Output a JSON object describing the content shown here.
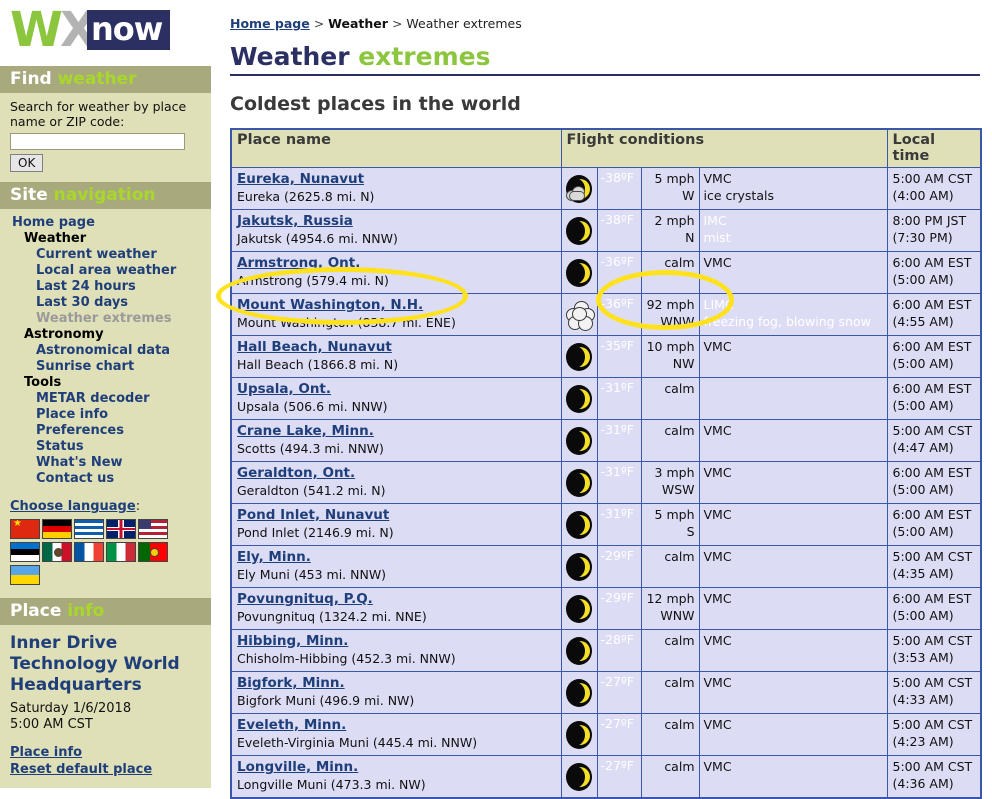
{
  "logo": {
    "part1": "W",
    "part2": "X",
    "part3": "now"
  },
  "find_weather": {
    "head_1": "Find",
    "head_2": "weather",
    "prompt": "Search for weather by place name or ZIP code:",
    "input_value": "",
    "input_placeholder": "",
    "ok_label": "OK"
  },
  "site_navigation": {
    "head_1": "Site",
    "head_2": "navigation",
    "items": [
      {
        "label": "Home page",
        "level": 0,
        "type": "link"
      },
      {
        "label": "Weather",
        "level": 1,
        "type": "plain"
      },
      {
        "label": "Current weather",
        "level": 2,
        "type": "link"
      },
      {
        "label": "Local area weather",
        "level": 2,
        "type": "link"
      },
      {
        "label": "Last 24 hours",
        "level": 2,
        "type": "link"
      },
      {
        "label": "Last 30 days",
        "level": 2,
        "type": "link"
      },
      {
        "label": "Weather extremes",
        "level": 2,
        "type": "current"
      },
      {
        "label": "Astronomy",
        "level": 1,
        "type": "plain"
      },
      {
        "label": "Astronomical data",
        "level": 2,
        "type": "link"
      },
      {
        "label": "Sunrise chart",
        "level": 2,
        "type": "link"
      },
      {
        "label": "Tools",
        "level": 1,
        "type": "plain"
      },
      {
        "label": "METAR decoder",
        "level": 2,
        "type": "link"
      },
      {
        "label": "Place info",
        "level": 2,
        "type": "link"
      },
      {
        "label": "Preferences",
        "level": 2,
        "type": "link"
      },
      {
        "label": "Status",
        "level": 2,
        "type": "link"
      },
      {
        "label": "What's New",
        "level": 2,
        "type": "link"
      },
      {
        "label": "Contact us",
        "level": 2,
        "type": "link"
      }
    ],
    "language_label": "Choose language",
    "language_colon": ":",
    "flags": [
      {
        "name": "china-flag",
        "colors": [
          "#de2910",
          "#ffde00"
        ]
      },
      {
        "name": "germany-flag",
        "colors": [
          "#000000",
          "#dd0000",
          "#ffce00"
        ]
      },
      {
        "name": "greece-flag",
        "colors": [
          "#0d5eaf",
          "#ffffff"
        ]
      },
      {
        "name": "united-kingdom-flag",
        "colors": [
          "#012169",
          "#ffffff",
          "#c8102e"
        ]
      },
      {
        "name": "usa-flag",
        "colors": [
          "#b22234",
          "#ffffff",
          "#3c3b6e"
        ]
      },
      {
        "name": "estonia-flag",
        "colors": [
          "#0072ce",
          "#000000",
          "#ffffff"
        ]
      },
      {
        "name": "mexico-flag",
        "colors": [
          "#006847",
          "#ffffff",
          "#ce1126"
        ]
      },
      {
        "name": "france-flag",
        "colors": [
          "#0055a4",
          "#ffffff",
          "#ef4135"
        ]
      },
      {
        "name": "italy-flag",
        "colors": [
          "#009246",
          "#ffffff",
          "#ce2b37"
        ]
      },
      {
        "name": "portugal-flag",
        "colors": [
          "#006600",
          "#ff0000",
          "#ffcc00"
        ]
      },
      {
        "name": "ukraine-flag",
        "colors": [
          "#5aa5e8",
          "#ffd700"
        ]
      }
    ]
  },
  "place_info": {
    "head_1": "Place",
    "head_2": "info",
    "place_name": "Inner Drive Technology World Headquarters",
    "date": "Saturday 1/6/2018",
    "time": "5:00 AM CST",
    "links": [
      "Place info",
      "Reset default place"
    ]
  },
  "breadcrumb": {
    "home": "Home page",
    "sep1": ">",
    "section": "Weather",
    "sep2": ">",
    "current": "Weather extremes"
  },
  "header": {
    "title_1": "Weather",
    "title_2": "extremes"
  },
  "main": {
    "section_title": "Coldest places in the world"
  },
  "table": {
    "columns": {
      "place_name": "Place name",
      "flight_conditions": "Flight conditions",
      "local_time": "Local time"
    },
    "rows": [
      {
        "place": "Eureka, Nunavut",
        "station": "Eureka (2625.8 mi. N)",
        "icon": "moon-cloud-icon",
        "temp": "-38ºF",
        "wind": "5 mph",
        "wind_dir": "W",
        "cond": "VMC",
        "cond_detail": "ice crystals",
        "cond_type": "vmc",
        "time": "5:00 AM CST",
        "obs_time": "(4:00 AM)"
      },
      {
        "place": "Jakutsk, Russia",
        "station": "Jakutsk (4954.6 mi. NNW)",
        "icon": "moon-icon",
        "temp": "-38ºF",
        "wind": "2 mph",
        "wind_dir": "N",
        "cond": "IMC",
        "cond_detail": "mist",
        "cond_type": "imc",
        "time": "8:00 PM JST",
        "obs_time": "(7:30 PM)"
      },
      {
        "place": "Armstrong, Ont.",
        "station": "Armstrong (579.4 mi. N)",
        "icon": "moon-icon",
        "temp": "-36ºF",
        "wind": "calm",
        "wind_dir": "",
        "cond": "VMC",
        "cond_detail": "",
        "cond_type": "vmc",
        "time": "6:00 AM EST",
        "obs_time": "(5:00 AM)"
      },
      {
        "place": "Mount Washington, N.H.",
        "station": "Mount Washington (838.7 mi. ENE)",
        "icon": "cloud-icon",
        "temp": "-36ºF",
        "wind": "92 mph",
        "wind_dir": "WNW",
        "cond": "LIMC",
        "cond_detail": "freezing fog, blowing snow",
        "cond_type": "imc",
        "time": "6:00 AM EST",
        "obs_time": "(4:55 AM)"
      },
      {
        "place": "Hall Beach, Nunavut",
        "station": "Hall Beach (1866.8 mi. N)",
        "icon": "moon-icon",
        "temp": "-35ºF",
        "wind": "10 mph",
        "wind_dir": "NW",
        "cond": "VMC",
        "cond_detail": "",
        "cond_type": "vmc",
        "time": "6:00 AM EST",
        "obs_time": "(5:00 AM)"
      },
      {
        "place": "Upsala, Ont.",
        "station": "Upsala (506.6 mi. NNW)",
        "icon": "moon-icon",
        "temp": "-31ºF",
        "wind": "calm",
        "wind_dir": "",
        "cond": "",
        "cond_detail": "",
        "cond_type": "none",
        "time": "6:00 AM EST",
        "obs_time": "(5:00 AM)"
      },
      {
        "place": "Crane Lake, Minn.",
        "station": "Scotts (494.3 mi. NNW)",
        "icon": "moon-icon",
        "temp": "-31ºF",
        "wind": "calm",
        "wind_dir": "",
        "cond": "VMC",
        "cond_detail": "",
        "cond_type": "vmc",
        "time": "5:00 AM CST",
        "obs_time": "(4:47 AM)"
      },
      {
        "place": "Geraldton, Ont.",
        "station": "Geraldton (541.2 mi. N)",
        "icon": "moon-icon",
        "temp": "-31ºF",
        "wind": "3 mph",
        "wind_dir": "WSW",
        "cond": "VMC",
        "cond_detail": "",
        "cond_type": "vmc",
        "time": "6:00 AM EST",
        "obs_time": "(5:00 AM)"
      },
      {
        "place": "Pond Inlet, Nunavut",
        "station": "Pond Inlet (2146.9 mi. N)",
        "icon": "moon-icon",
        "temp": "-31ºF",
        "wind": "5 mph",
        "wind_dir": "S",
        "cond": "VMC",
        "cond_detail": "",
        "cond_type": "vmc",
        "time": "6:00 AM EST",
        "obs_time": "(5:00 AM)"
      },
      {
        "place": "Ely, Minn.",
        "station": "Ely Muni (453 mi. NNW)",
        "icon": "moon-icon",
        "temp": "-29ºF",
        "wind": "calm",
        "wind_dir": "",
        "cond": "VMC",
        "cond_detail": "",
        "cond_type": "vmc",
        "time": "5:00 AM CST",
        "obs_time": "(4:35 AM)"
      },
      {
        "place": "Povungnituq, P.Q.",
        "station": "Povungnituq (1324.2 mi. NNE)",
        "icon": "moon-icon",
        "temp": "-29ºF",
        "wind": "12 mph",
        "wind_dir": "WNW",
        "cond": "VMC",
        "cond_detail": "",
        "cond_type": "vmc",
        "time": "6:00 AM EST",
        "obs_time": "(5:00 AM)"
      },
      {
        "place": "Hibbing, Minn.",
        "station": "Chisholm-Hibbing (452.3 mi. NNW)",
        "icon": "moon-icon",
        "temp": "-28ºF",
        "wind": "calm",
        "wind_dir": "",
        "cond": "VMC",
        "cond_detail": "",
        "cond_type": "vmc",
        "time": "5:00 AM CST",
        "obs_time": "(3:53 AM)"
      },
      {
        "place": "Bigfork, Minn.",
        "station": "Bigfork Muni (496.9 mi. NW)",
        "icon": "moon-icon",
        "temp": "-27ºF",
        "wind": "calm",
        "wind_dir": "",
        "cond": "VMC",
        "cond_detail": "",
        "cond_type": "vmc",
        "time": "5:00 AM CST",
        "obs_time": "(4:33 AM)"
      },
      {
        "place": "Eveleth, Minn.",
        "station": "Eveleth-Virginia Muni (445.4 mi. NNW)",
        "icon": "moon-icon",
        "temp": "-27ºF",
        "wind": "calm",
        "wind_dir": "",
        "cond": "VMC",
        "cond_detail": "",
        "cond_type": "vmc",
        "time": "5:00 AM CST",
        "obs_time": "(4:23 AM)"
      },
      {
        "place": "Longville, Minn.",
        "station": "Longville Muni (473.3 mi. NW)",
        "icon": "moon-icon",
        "temp": "-27ºF",
        "wind": "calm",
        "wind_dir": "",
        "cond": "VMC",
        "cond_detail": "",
        "cond_type": "vmc",
        "time": "5:00 AM CST",
        "obs_time": "(4:36 AM)"
      }
    ]
  },
  "annotations": [
    {
      "name": "highlight-place-mount-washington",
      "color": "#ffe21c"
    },
    {
      "name": "highlight-conditions-mount-washington",
      "color": "#ffe21c"
    }
  ],
  "colors": {
    "brand_green": "#8cc63e",
    "brand_navy": "#2b2f62",
    "panel_bg": "#e0e0b8",
    "panel_head": "#a9a97e",
    "link": "#1f3f7a",
    "temp_red": "#ff0000",
    "vmc_green": "#7cf34e",
    "row_lavender": "#dcdcf5",
    "table_border": "#3a57a8",
    "annotation_yellow": "#ffe21c"
  }
}
